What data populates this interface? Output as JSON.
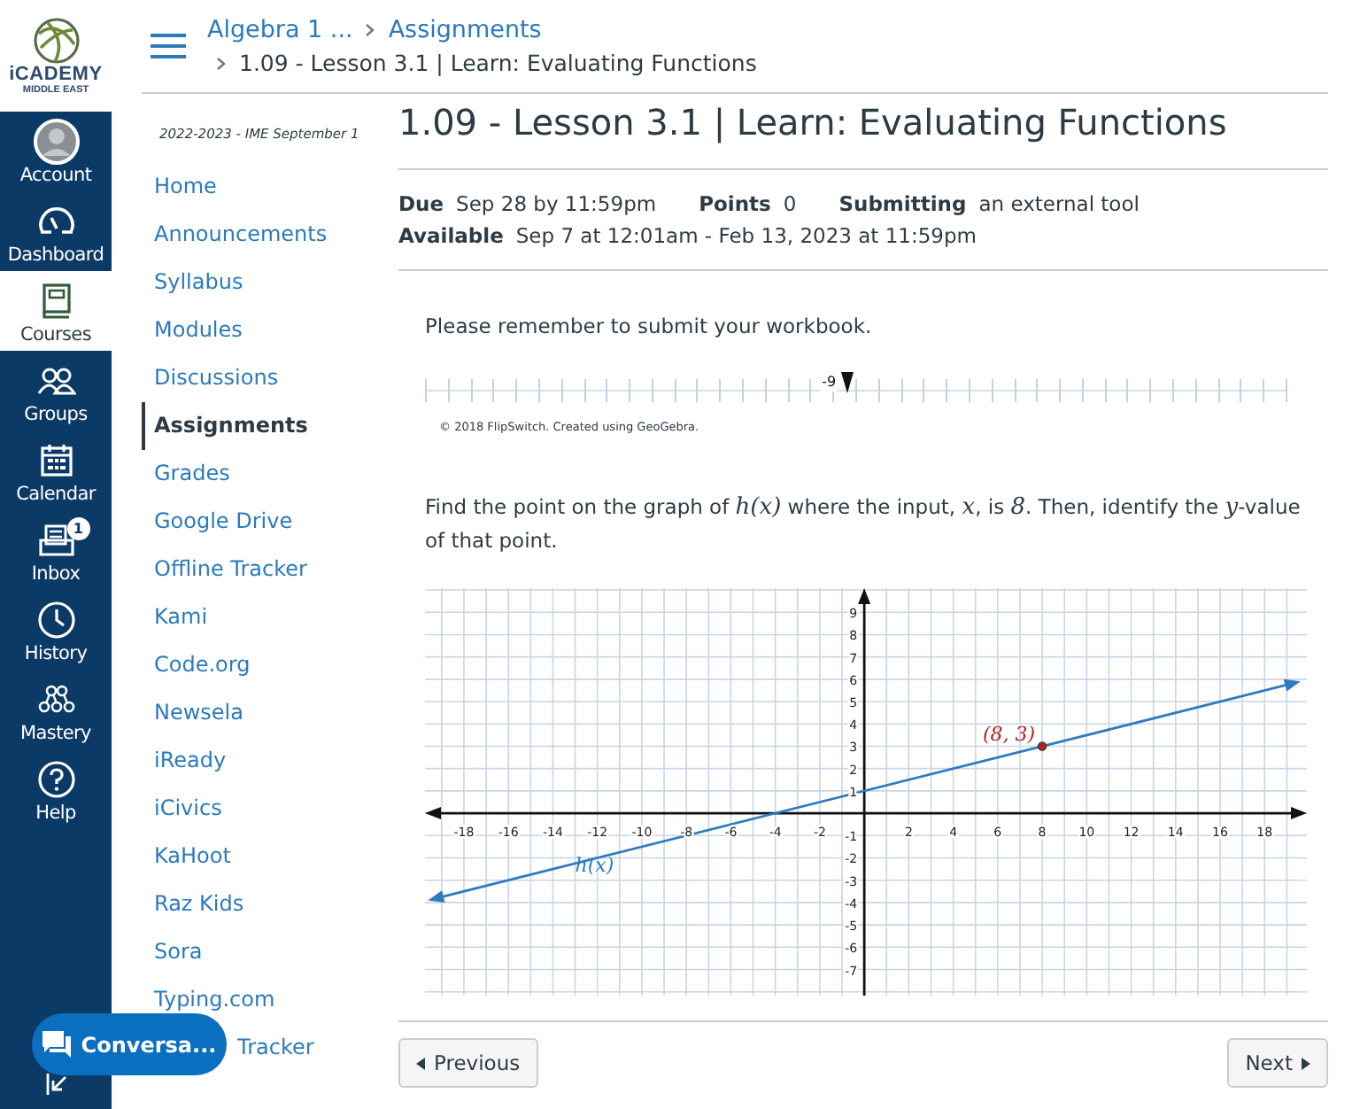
{
  "logo": {
    "name": "iCADEMY",
    "sub": "MIDDLE EAST"
  },
  "global_nav": [
    {
      "label": "Account",
      "selected": false
    },
    {
      "label": "Dashboard",
      "selected": false
    },
    {
      "label": "Courses",
      "selected": true
    },
    {
      "label": "Groups",
      "selected": false
    },
    {
      "label": "Calendar",
      "selected": false
    },
    {
      "label": "Inbox",
      "selected": false,
      "badge": "1"
    },
    {
      "label": "History",
      "selected": false
    },
    {
      "label": "Mastery",
      "selected": false
    },
    {
      "label": "Help",
      "selected": false
    }
  ],
  "breadcrumbs": {
    "course": "Algebra 1 ...",
    "section": "Assignments",
    "page": "1.09 - Lesson 3.1 | Learn: Evaluating Functions"
  },
  "course_nav": {
    "term": "2022-2023 - IME September 1",
    "items": [
      {
        "label": "Home",
        "selected": false
      },
      {
        "label": "Announcements",
        "selected": false
      },
      {
        "label": "Syllabus",
        "selected": false
      },
      {
        "label": "Modules",
        "selected": false
      },
      {
        "label": "Discussions",
        "selected": false
      },
      {
        "label": "Assignments",
        "selected": true
      },
      {
        "label": "Grades",
        "selected": false
      },
      {
        "label": "Google Drive",
        "selected": false
      },
      {
        "label": "Offline Tracker",
        "selected": false
      },
      {
        "label": "Kami",
        "selected": false
      },
      {
        "label": "Code.org",
        "selected": false
      },
      {
        "label": "Newsela",
        "selected": false
      },
      {
        "label": "iReady",
        "selected": false
      },
      {
        "label": "iCivics",
        "selected": false
      },
      {
        "label": "KaHoot",
        "selected": false
      },
      {
        "label": "Raz Kids",
        "selected": false
      },
      {
        "label": "Sora",
        "selected": false
      },
      {
        "label": "Typing.com",
        "selected": false
      },
      {
        "label": "Tracker",
        "selected": false
      }
    ]
  },
  "title": "1.09 - Lesson 3.1 | Learn: Evaluating Functions",
  "details": [
    [
      {
        "label": "Due",
        "value": "Sep 28 by 11:59pm"
      },
      {
        "label": "Points",
        "value": "0"
      },
      {
        "label": "Submitting",
        "value": "an external tool"
      }
    ],
    [
      {
        "label": "Available",
        "value": "Sep 7 at 12:01am - Feb 13, 2023 at 11:59pm"
      }
    ]
  ],
  "reminder": "Please remember to submit your workbook.",
  "slider": {
    "value": "-9",
    "level": 0.49,
    "credit": "© 2018 FlipSwitch. Created using GeoGebra."
  },
  "question": [
    {
      "text": "Find the point on the graph of ",
      "math": false
    },
    {
      "text": "h(x)",
      "math": true
    },
    {
      "text": " where the input, ",
      "math": false
    },
    {
      "text": "x",
      "math": true
    },
    {
      "text": ", is ",
      "math": false
    },
    {
      "text": "8",
      "math": true
    },
    {
      "text": ". Then, identify the ",
      "math": false
    },
    {
      "text": "y",
      "math": true
    },
    {
      "text": "-value of that point.",
      "math": false
    }
  ],
  "graph": {
    "chart_data": {
      "type": "line",
      "grid": true,
      "x": [
        -19,
        19
      ],
      "series": [
        {
          "name": "h(x)",
          "color": "#2f7bbf",
          "marker": "triangle",
          "values": [
            -3.75,
            5.75
          ]
        }
      ],
      "xlim": [
        -19.75,
        19.9
      ],
      "ylim": [
        -8.17,
        10.08
      ],
      "xticks": [
        -18,
        -16,
        -14,
        -12,
        -10,
        -8,
        -6,
        -4,
        -2,
        2,
        4,
        6,
        8,
        10,
        12,
        14,
        16,
        18
      ],
      "yticks": [
        -7,
        -6,
        -5,
        -4,
        -3,
        -2,
        -1,
        1,
        2,
        3,
        4,
        5,
        6,
        7,
        8,
        9
      ],
      "annotations": [
        {
          "x": 8,
          "y": 3,
          "text": "(8, 3)"
        }
      ]
    }
  },
  "buttons": {
    "previous": "Previous",
    "next": "Next"
  },
  "chat_button": "Conversa..."
}
